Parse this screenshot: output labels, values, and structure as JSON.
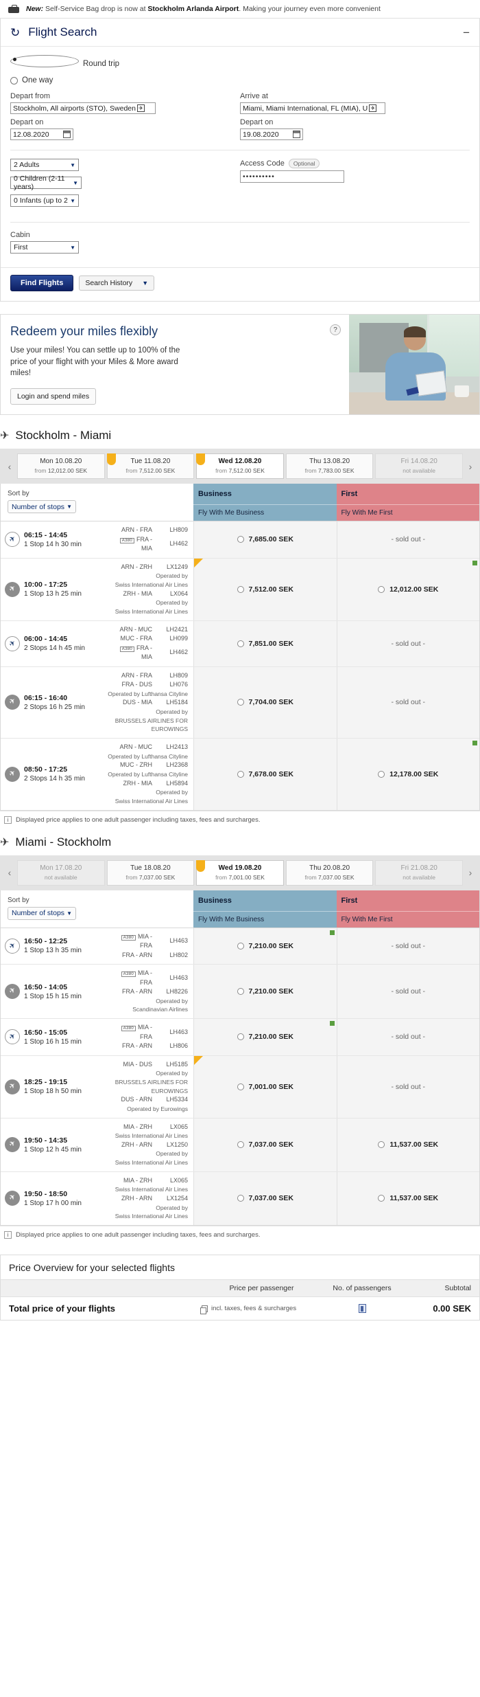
{
  "notice": {
    "prefix": "New:",
    "text_before": " Self-Service Bag drop is now at ",
    "venue": "Stockholm Arlanda Airport",
    "text_after": ". Making your journey even more convenient",
    "icon": "bag-icon"
  },
  "search": {
    "title": "Flight Search",
    "refresh_icon": "refresh-icon",
    "collapse_label": "−",
    "trip_types": [
      {
        "label": "Round trip",
        "selected": true
      },
      {
        "label": "One way",
        "selected": false
      }
    ],
    "depart_from": {
      "label": "Depart from",
      "value": "Stockholm, All airports (STO), Sweden"
    },
    "arrive_at": {
      "label": "Arrive at",
      "value": "Miami, Miami International, FL (MIA), U"
    },
    "depart_on_out": {
      "label": "Depart on",
      "value": "12.08.2020"
    },
    "depart_on_ret": {
      "label": "Depart on",
      "value": "19.08.2020"
    },
    "adults": "2 Adults",
    "children": "0 Children (2-11 years)",
    "infants": "0 Infants (up to 2",
    "access_code": {
      "label": "Access Code",
      "optional": "Optional",
      "value": "••••••••••"
    },
    "cabin": {
      "label": "Cabin",
      "value": "First"
    },
    "find_button": "Find Flights",
    "history_button": "Search History"
  },
  "promo": {
    "title": "Redeem your miles flexibly",
    "body": "Use your miles! You can settle up to 100% of the price of your flight with your Miles & More award miles!",
    "button": "Login and spend miles",
    "help": "?"
  },
  "outbound": {
    "route_title": "Stockholm - Miami",
    "dates": [
      {
        "day": "Mon 10.08.20",
        "from": "from",
        "price": "12,012.00 SEK",
        "active": false,
        "tagged": false,
        "available": true
      },
      {
        "day": "Tue 11.08.20",
        "from": "from",
        "price": "7,512.00 SEK",
        "active": false,
        "tagged": true,
        "available": true
      },
      {
        "day": "Wed 12.08.20",
        "from": "from",
        "price": "7,512.00 SEK",
        "active": true,
        "tagged": true,
        "available": true
      },
      {
        "day": "Thu 13.08.20",
        "from": "from",
        "price": "7,783.00 SEK",
        "active": false,
        "tagged": false,
        "available": true
      },
      {
        "day": "Fri 14.08.20",
        "from": "",
        "price": "not available",
        "active": false,
        "tagged": false,
        "available": false
      }
    ],
    "sort_label": "Sort by",
    "sort_value": "Number of stops",
    "classes": [
      {
        "name": "Business",
        "fare": "Fly With Me Business"
      },
      {
        "name": "First",
        "fare": "Fly With Me First"
      }
    ],
    "flights": [
      {
        "airline_icon": "lufthansa-logo-icon",
        "times": "06:15 - 14:45",
        "stops": "1 Stop 14 h 30 min",
        "segments": [
          {
            "route": "ARN - FRA",
            "flight": "LH809",
            "a380": false
          },
          {
            "route": "FRA - MIA",
            "flight": "LH462",
            "a380": true
          }
        ],
        "business": {
          "price": "7,685.00 SEK",
          "selectable": true,
          "tagged": false,
          "green": false
        },
        "first": {
          "price": "- sold out -",
          "selectable": false,
          "tagged": false,
          "green": false
        }
      },
      {
        "airline_icon": "plane-circle-icon",
        "times": "10:00 - 17:25",
        "stops": "1 Stop 13 h 25 min",
        "segments": [
          {
            "route": "ARN - ZRH",
            "flight": "LX1249",
            "a380": false
          },
          {
            "operated_by": "Operated by"
          },
          {
            "operator": "Swiss International Air Lines"
          },
          {
            "route": "ZRH - MIA",
            "flight": "LX064",
            "a380": false
          },
          {
            "operated_by": "Operated by"
          },
          {
            "operator": "Swiss International Air Lines"
          }
        ],
        "business": {
          "price": "7,512.00 SEK",
          "selectable": true,
          "tagged": true,
          "green": false
        },
        "first": {
          "price": "12,012.00 SEK",
          "selectable": true,
          "tagged": false,
          "green": true
        }
      },
      {
        "airline_icon": "lufthansa-logo-icon",
        "times": "06:00 - 14:45",
        "stops": "2 Stops 14 h 45 min",
        "segments": [
          {
            "route": "ARN - MUC",
            "flight": "LH2421",
            "a380": false
          },
          {
            "route": "MUC - FRA",
            "flight": "LH099",
            "a380": false
          },
          {
            "route": "FRA - MIA",
            "flight": "LH462",
            "a380": true
          }
        ],
        "business": {
          "price": "7,851.00 SEK",
          "selectable": true,
          "tagged": false,
          "green": false
        },
        "first": {
          "price": "- sold out -",
          "selectable": false,
          "tagged": false,
          "green": false
        }
      },
      {
        "airline_icon": "plane-circle-icon",
        "times": "06:15 - 16:40",
        "stops": "2 Stops 16 h 25 min",
        "segments": [
          {
            "route": "ARN - FRA",
            "flight": "LH809",
            "a380": false
          },
          {
            "route": "FRA - DUS",
            "flight": "LH076",
            "a380": false
          },
          {
            "operator": "Operated by Lufthansa Cityline"
          },
          {
            "route": "DUS - MIA",
            "flight": "LH5184",
            "a380": false
          },
          {
            "operated_by": "Operated by"
          },
          {
            "operator": "BRUSSELS AIRLINES FOR"
          },
          {
            "operator": "EUROWINGS"
          }
        ],
        "business": {
          "price": "7,704.00 SEK",
          "selectable": true,
          "tagged": false,
          "green": false
        },
        "first": {
          "price": "- sold out -",
          "selectable": false,
          "tagged": false,
          "green": false
        }
      },
      {
        "airline_icon": "plane-circle-icon",
        "times": "08:50 - 17:25",
        "stops": "2 Stops 14 h 35 min",
        "segments": [
          {
            "route": "ARN - MUC",
            "flight": "LH2413",
            "a380": false
          },
          {
            "operator": "Operated by Lufthansa Cityline"
          },
          {
            "route": "MUC - ZRH",
            "flight": "LH2368",
            "a380": false
          },
          {
            "operator": "Operated by Lufthansa Cityline"
          },
          {
            "route": "ZRH - MIA",
            "flight": "LH5894",
            "a380": false
          },
          {
            "operated_by": "Operated by"
          },
          {
            "operator": "Swiss International Air Lines"
          }
        ],
        "business": {
          "price": "7,678.00 SEK",
          "selectable": true,
          "tagged": false,
          "green": false
        },
        "first": {
          "price": "12,178.00 SEK",
          "selectable": true,
          "tagged": false,
          "green": true
        }
      }
    ],
    "note": "Displayed price applies to one adult passenger including taxes, fees and surcharges."
  },
  "inbound": {
    "route_title": "Miami - Stockholm",
    "dates": [
      {
        "day": "Mon 17.08.20",
        "from": "",
        "price": "not available",
        "active": false,
        "tagged": false,
        "available": false
      },
      {
        "day": "Tue 18.08.20",
        "from": "from",
        "price": "7,037.00 SEK",
        "active": false,
        "tagged": false,
        "available": true
      },
      {
        "day": "Wed 19.08.20",
        "from": "from",
        "price": "7,001.00 SEK",
        "active": true,
        "tagged": true,
        "available": true
      },
      {
        "day": "Thu 20.08.20",
        "from": "from",
        "price": "7,037.00 SEK",
        "active": false,
        "tagged": false,
        "available": true
      },
      {
        "day": "Fri 21.08.20",
        "from": "",
        "price": "not available",
        "active": false,
        "tagged": false,
        "available": false
      }
    ],
    "sort_label": "Sort by",
    "sort_value": "Number of stops",
    "classes": [
      {
        "name": "Business",
        "fare": "Fly With Me Business"
      },
      {
        "name": "First",
        "fare": "Fly With Me First"
      }
    ],
    "flights": [
      {
        "airline_icon": "lufthansa-logo-icon",
        "times": "16:50 - 12:25",
        "stops": "1 Stop 13 h 35 min",
        "segments": [
          {
            "route": "MIA - FRA",
            "flight": "LH463",
            "a380": true
          },
          {
            "route": "FRA - ARN",
            "flight": "LH802",
            "a380": false
          }
        ],
        "business": {
          "price": "7,210.00 SEK",
          "selectable": true,
          "tagged": false,
          "green": true
        },
        "first": {
          "price": "- sold out -",
          "selectable": false,
          "tagged": false,
          "green": false
        }
      },
      {
        "airline_icon": "plane-circle-icon",
        "times": "16:50 - 14:05",
        "stops": "1 Stop 15 h 15 min",
        "segments": [
          {
            "route": "MIA - FRA",
            "flight": "LH463",
            "a380": true
          },
          {
            "route": "FRA - ARN",
            "flight": "LH8226",
            "a380": false
          },
          {
            "operated_by": "Operated by"
          },
          {
            "operator": "Scandinavian Airlines"
          }
        ],
        "business": {
          "price": "7,210.00 SEK",
          "selectable": true,
          "tagged": false,
          "green": false
        },
        "first": {
          "price": "- sold out -",
          "selectable": false,
          "tagged": false,
          "green": false
        }
      },
      {
        "airline_icon": "lufthansa-logo-icon",
        "times": "16:50 - 15:05",
        "stops": "1 Stop 16 h 15 min",
        "segments": [
          {
            "route": "MIA - FRA",
            "flight": "LH463",
            "a380": true
          },
          {
            "route": "FRA - ARN",
            "flight": "LH806",
            "a380": false
          }
        ],
        "business": {
          "price": "7,210.00 SEK",
          "selectable": true,
          "tagged": false,
          "green": true
        },
        "first": {
          "price": "- sold out -",
          "selectable": false,
          "tagged": false,
          "green": false
        }
      },
      {
        "airline_icon": "plane-circle-icon",
        "times": "18:25 - 19:15",
        "stops": "1 Stop 18 h 50 min",
        "segments": [
          {
            "route": "MIA - DUS",
            "flight": "LH5185",
            "a380": false
          },
          {
            "operated_by": "Operated by"
          },
          {
            "operator": "BRUSSELS AIRLINES FOR"
          },
          {
            "operator": "EUROWINGS"
          },
          {
            "route": "DUS - ARN",
            "flight": "LH5334",
            "a380": false
          },
          {
            "operator": "Operated by Eurowings"
          }
        ],
        "business": {
          "price": "7,001.00 SEK",
          "selectable": true,
          "tagged": true,
          "green": false
        },
        "first": {
          "price": "- sold out -",
          "selectable": false,
          "tagged": false,
          "green": false
        }
      },
      {
        "airline_icon": "plane-circle-icon",
        "times": "19:50 - 14:35",
        "stops": "1 Stop 12 h 45 min",
        "segments": [
          {
            "route": "MIA - ZRH",
            "flight": "LX065",
            "a380": false
          },
          {
            "operator": "Swiss International Air Lines"
          },
          {
            "route": "ZRH - ARN",
            "flight": "LX1250",
            "a380": false
          },
          {
            "operated_by": "Operated by"
          },
          {
            "operator": "Swiss International Air Lines"
          }
        ],
        "business": {
          "price": "7,037.00 SEK",
          "selectable": true,
          "tagged": false,
          "green": false
        },
        "first": {
          "price": "11,537.00 SEK",
          "selectable": true,
          "tagged": false,
          "green": false
        }
      },
      {
        "airline_icon": "plane-circle-icon",
        "times": "19:50 - 18:50",
        "stops": "1 Stop 17 h 00 min",
        "segments": [
          {
            "route": "MIA - ZRH",
            "flight": "LX065",
            "a380": false
          },
          {
            "operator": "Swiss International Air Lines"
          },
          {
            "route": "ZRH - ARN",
            "flight": "LX1254",
            "a380": false
          },
          {
            "operated_by": "Operated by"
          },
          {
            "operator": "Swiss International Air Lines"
          }
        ],
        "business": {
          "price": "7,037.00 SEK",
          "selectable": true,
          "tagged": false,
          "green": false
        },
        "first": {
          "price": "11,537.00 SEK",
          "selectable": true,
          "tagged": false,
          "green": false
        }
      }
    ],
    "note": "Displayed price applies to one adult passenger including taxes, fees and surcharges."
  },
  "price_overview": {
    "title": "Price Overview for your selected flights",
    "columns": [
      "",
      "Price per passenger",
      "No. of passengers",
      "Subtotal"
    ],
    "total_label": "Total price of your flights",
    "incl_text": "incl. taxes, fees & surcharges",
    "total_amount": "0.00 SEK"
  },
  "colors": {
    "brand_navy": "#05164d",
    "business": "#85aec3",
    "first": "#de8389",
    "tag_yellow": "#f5b01a",
    "green": "#5a9e3f"
  }
}
